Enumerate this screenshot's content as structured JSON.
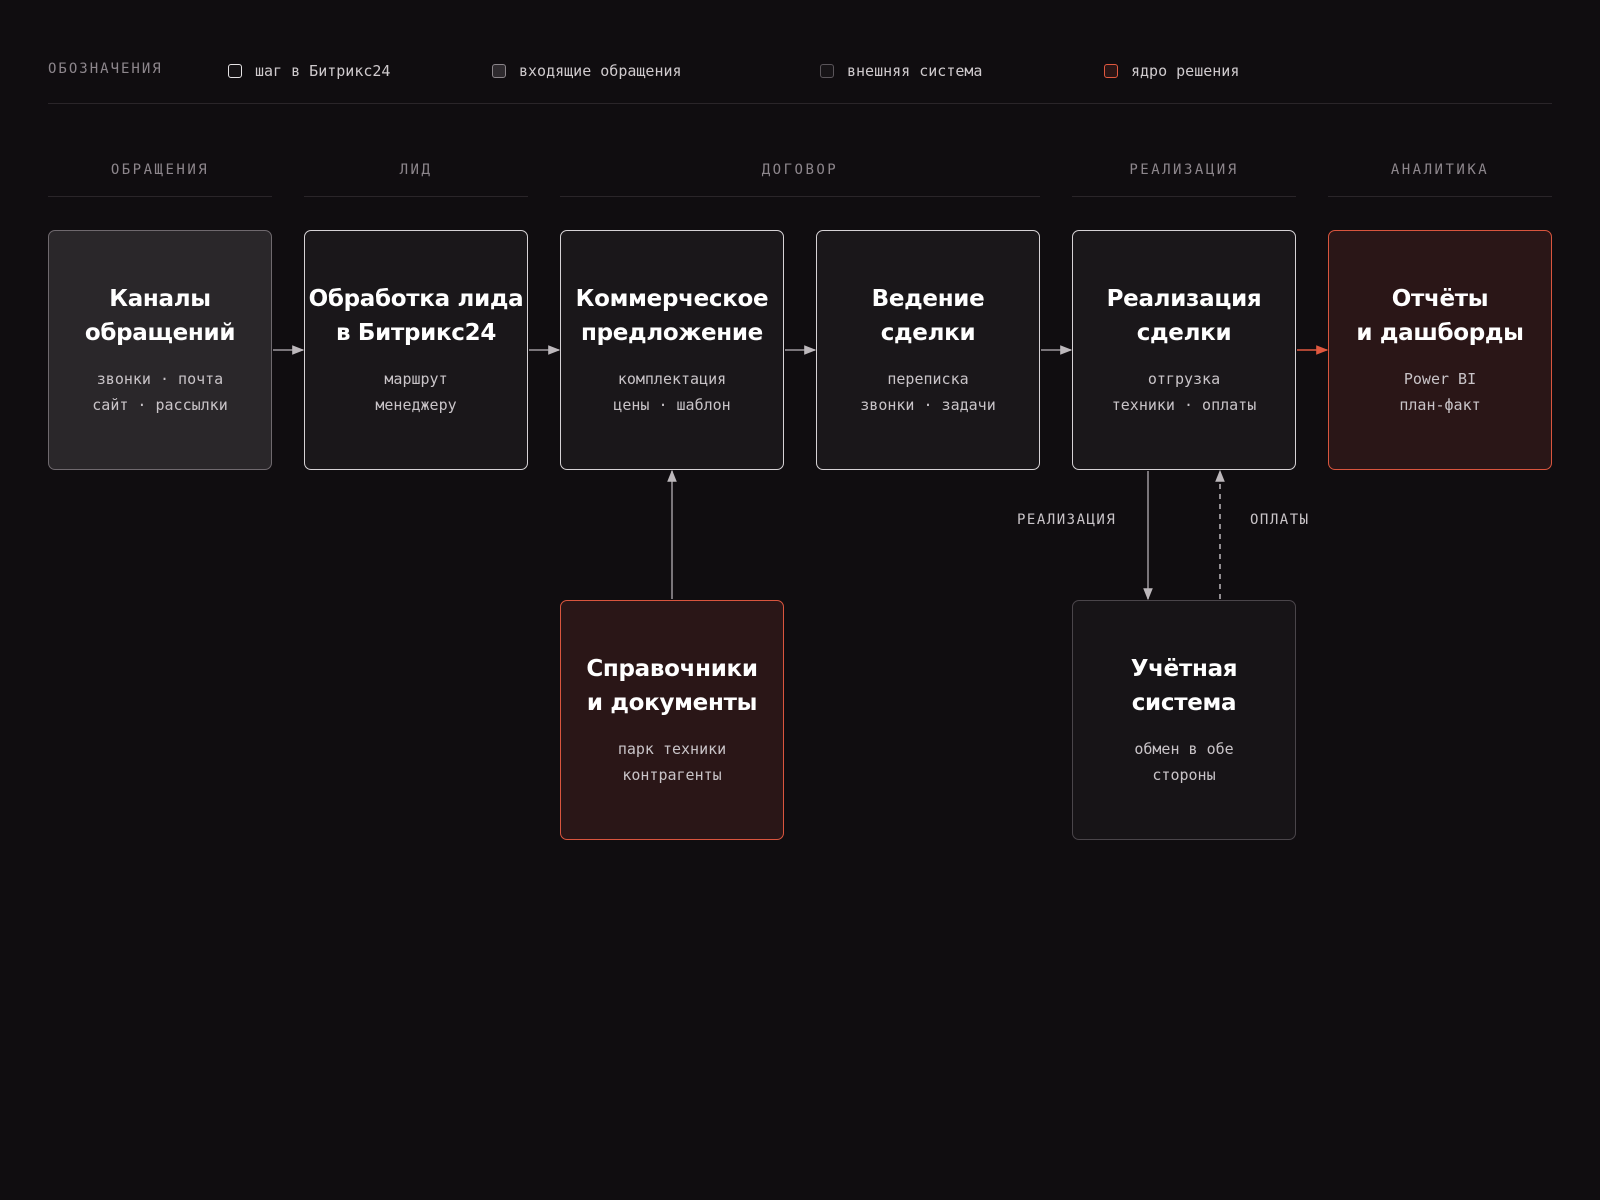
{
  "legend": {
    "title": "ОБОЗНАЧЕНИЯ",
    "items": [
      {
        "label": "шаг в Битрикс24",
        "kind": "step"
      },
      {
        "label": "входящие обращения",
        "kind": "incoming"
      },
      {
        "label": "внешняя система",
        "kind": "external"
      },
      {
        "label": "ядро решения",
        "kind": "core"
      }
    ]
  },
  "stages": [
    "ОБРАЩЕНИЯ",
    "ЛИД",
    "ДОГОВОР",
    "РЕАЛИЗАЦИЯ",
    "АНАЛИТИКА"
  ],
  "nodes": {
    "channels": {
      "title": "Каналы\nобращений",
      "sub": "звонки · почта\nсайт · рассылки",
      "kind": "incoming"
    },
    "lead": {
      "title": "Обработка лида\nв Битрикс24",
      "sub": "маршрут\nменеджеру",
      "kind": "step"
    },
    "offer": {
      "title": "Коммерческое\nпредложение",
      "sub": "комплектация\nцены · шаблон",
      "kind": "step"
    },
    "deal": {
      "title": "Ведение\nсделки",
      "sub": "переписка\nзвонки · задачи",
      "kind": "step"
    },
    "realization": {
      "title": "Реализация\nсделки",
      "sub": "отгрузка\nтехники · оплаты",
      "kind": "step"
    },
    "reports": {
      "title": "Отчёты\nи дашборды",
      "sub": "Power BI\nплан-факт",
      "kind": "core"
    },
    "references": {
      "title": "Справочники\nи документы",
      "sub": "парк техники\nконтрагенты",
      "kind": "core"
    },
    "accounting": {
      "title": "Учётная\nсистема",
      "sub": "обмен в обе\nстороны",
      "kind": "external"
    }
  },
  "edges": {
    "realization_label": "РЕАЛИЗАЦИЯ",
    "payments_label": "ОПЛАТЫ"
  },
  "colors": {
    "background": "#100d10",
    "core_accent": "#e0583f",
    "connector": "#bdb8bc"
  }
}
